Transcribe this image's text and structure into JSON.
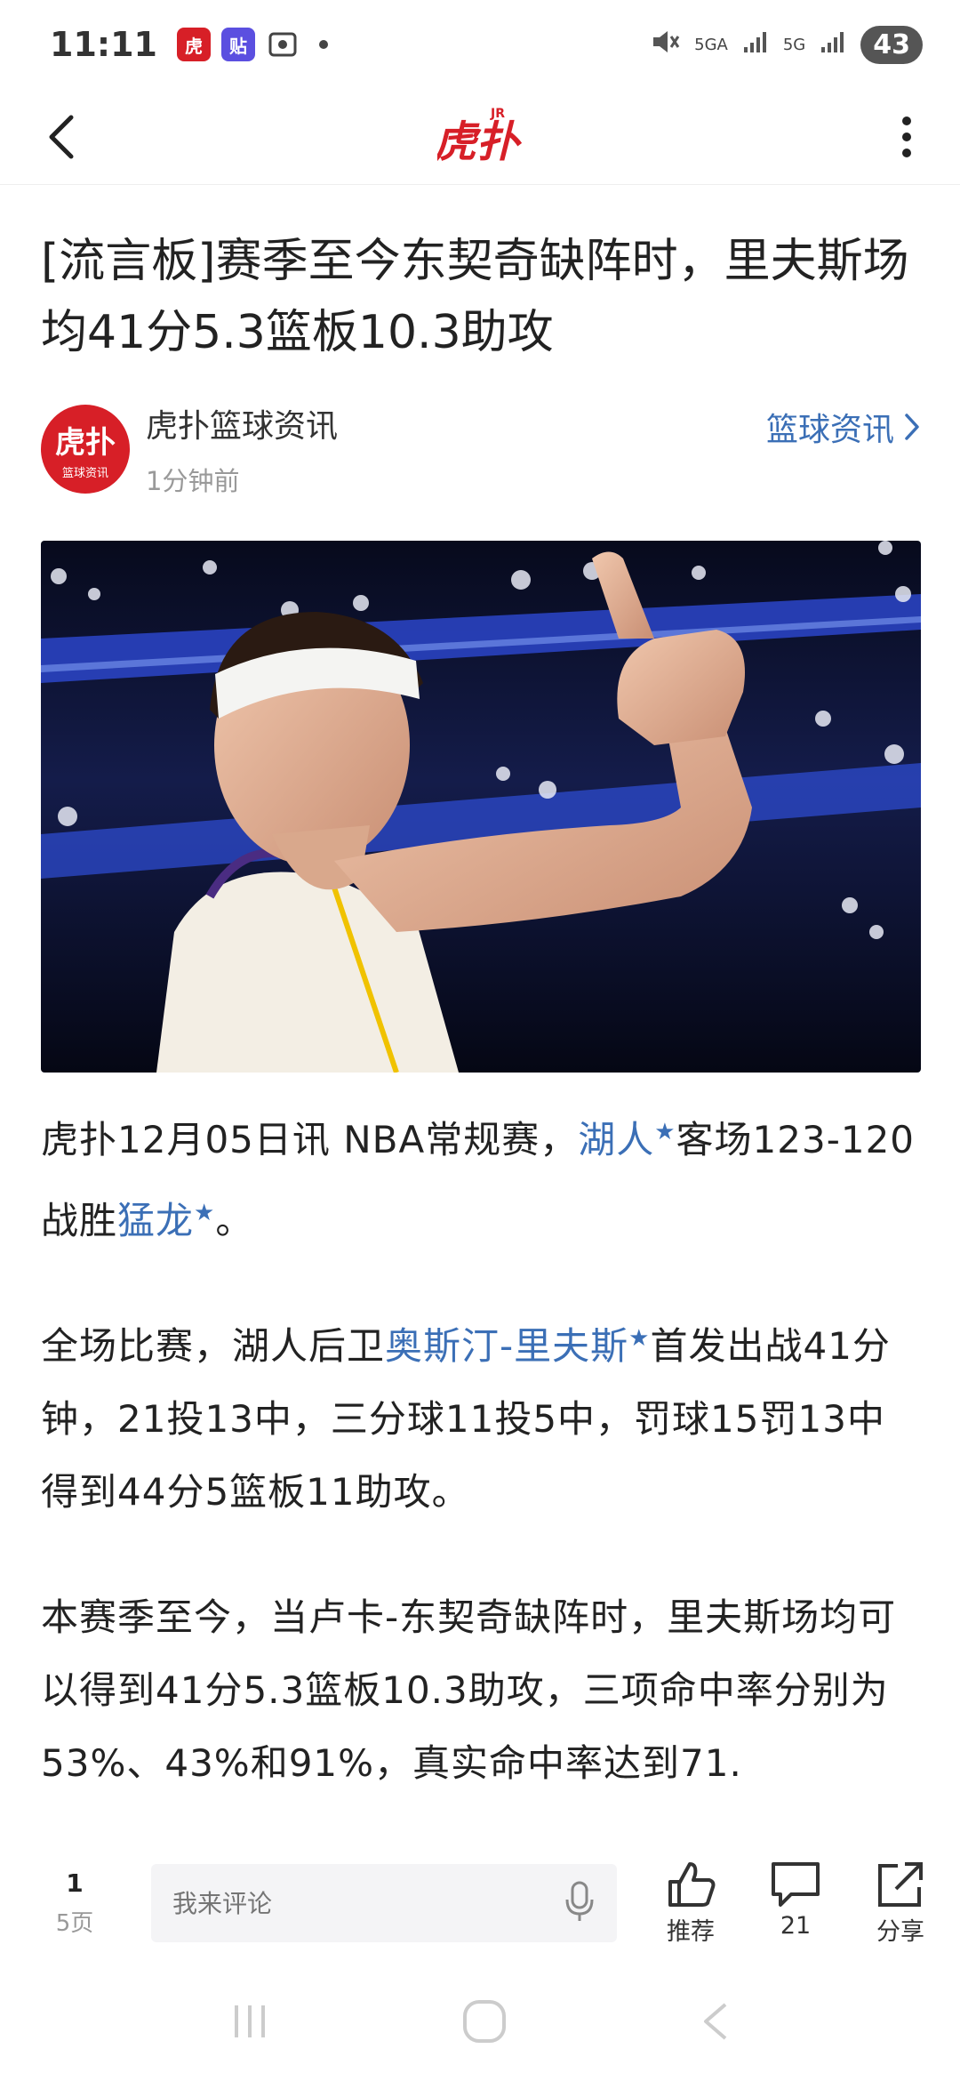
{
  "status_bar": {
    "time": "11:11",
    "battery": "43",
    "network_1": "5GA",
    "network_2": "5G",
    "icons": [
      "hupu-app-icon",
      "tieba-icon",
      "screenshot-icon",
      "dot-icon",
      "mute-icon",
      "signal-icon"
    ]
  },
  "app_bar": {
    "logo_text": "虎扑",
    "logo_badge": "JR"
  },
  "article": {
    "title": "[流言板]赛季至今东契奇缺阵时，里夫斯场均41分5.3篮板10.3助攻",
    "author": {
      "avatar_text": "虎扑",
      "avatar_sub": "篮球资讯",
      "name": "虎扑篮球资讯",
      "time": "1分钟前"
    },
    "channel": "篮球资讯",
    "p1": {
      "t1": "虎扑12月05日讯 NBA常规赛，",
      "link1": "湖人",
      "t2": "客场123-120战胜",
      "link2": "猛龙",
      "t3": "。"
    },
    "p2": {
      "t1": "全场比赛，湖人后卫",
      "link1": "奥斯汀-里夫斯",
      "t2": "首发出战41分钟，21投13中，三分球11投5中，罚球15罚13中得到44分5篮板11助攻。"
    },
    "p3": "本赛季至今，当卢卡-东契奇缺阵时，里夫斯场均可以得到41分5.3篮板10.3助攻，三项命中率分别为53%、43%和91%，真实命中率达到71."
  },
  "bottom_bar": {
    "page_current": "1",
    "page_total": "5页",
    "comment_placeholder": "我来评论",
    "recommend_label": "推荐",
    "comments_count": "21",
    "share_label": "分享"
  },
  "colors": {
    "brand_red": "#d71f27",
    "link_blue": "#3b6fb6"
  }
}
